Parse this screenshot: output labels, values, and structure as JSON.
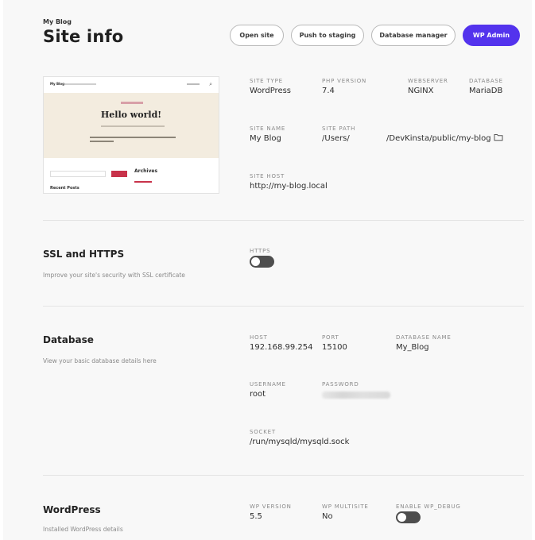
{
  "header": {
    "kicker": "My Blog",
    "title": "Site info",
    "buttons": {
      "open_site": "Open site",
      "push_staging": "Push to staging",
      "database_manager": "Database manager",
      "wp_admin": "WP Admin"
    }
  },
  "preview": {
    "site_title": "My Blog",
    "headline": "Hello world!",
    "archives": "Archives",
    "recent_posts": "Recent Posts"
  },
  "site_details": {
    "site_type": {
      "label": "SITE TYPE",
      "value": "WordPress"
    },
    "php_version": {
      "label": "PHP VERSION",
      "value": "7.4"
    },
    "webserver": {
      "label": "WEBSERVER",
      "value": "NGINX"
    },
    "database": {
      "label": "DATABASE",
      "value": "MariaDB"
    },
    "site_name": {
      "label": "SITE NAME",
      "value": "My Blog"
    },
    "site_path": {
      "label": "SITE PATH",
      "value_start": "/Users/",
      "value_end": "/DevKinsta/public/my-blog"
    },
    "site_host": {
      "label": "SITE HOST",
      "value": "http://my-blog.local"
    }
  },
  "ssl": {
    "title": "SSL and HTTPS",
    "description": "Improve your site's security with SSL certificate",
    "https_label": "HTTPS",
    "https_enabled": false
  },
  "database_section": {
    "title": "Database",
    "description": "View your basic database details here",
    "host": {
      "label": "HOST",
      "value": "192.168.99.254"
    },
    "port": {
      "label": "PORT",
      "value": "15100"
    },
    "db_name": {
      "label": "DATABASE NAME",
      "value": "My_Blog"
    },
    "username": {
      "label": "USERNAME",
      "value": "root"
    },
    "password": {
      "label": "PASSWORD"
    },
    "socket": {
      "label": "SOCKET",
      "value": "/run/mysqld/mysqld.sock"
    }
  },
  "wordpress": {
    "title": "WordPress",
    "description": "Installed WordPress details",
    "wp_version": {
      "label": "WP VERSION",
      "value": "5.5"
    },
    "wp_multisite": {
      "label": "WP MULTISITE",
      "value": "No"
    },
    "wp_debug": {
      "label": "ENABLE WP_DEBUG",
      "enabled": false
    }
  },
  "colors": {
    "accent": "#5333ed",
    "toggle_off": "#4e4e4e"
  }
}
